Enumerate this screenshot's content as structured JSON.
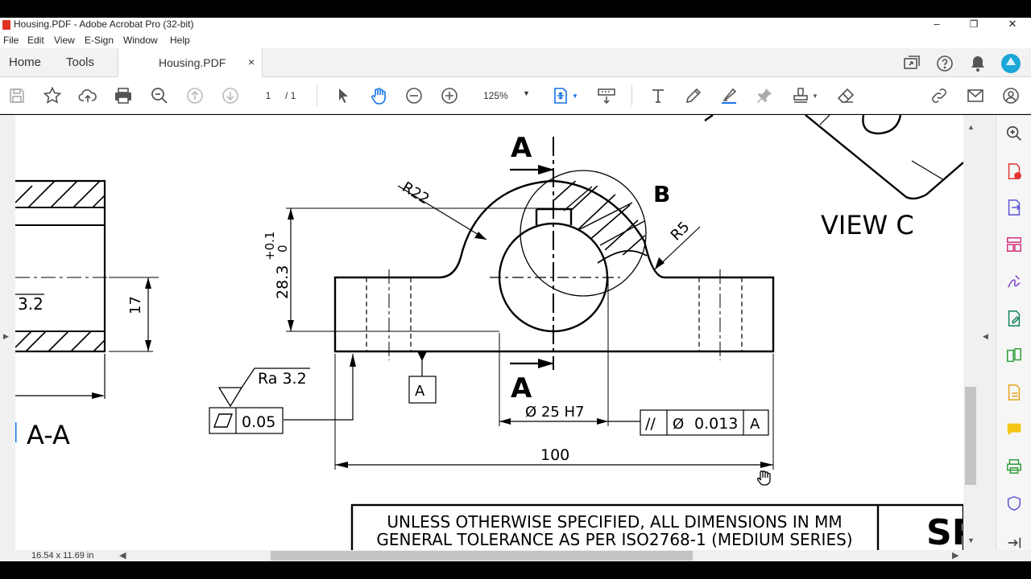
{
  "window": {
    "title": "Housing.PDF - Adobe Acrobat Pro (32-bit)",
    "minimize": "–",
    "restore": "❐",
    "close": "✕"
  },
  "menu": [
    "File",
    "Edit",
    "View",
    "E-Sign",
    "Window",
    "Help"
  ],
  "tabs": {
    "home": "Home",
    "tools": "Tools",
    "document": "Housing.PDF",
    "close": "×"
  },
  "toolbar": {
    "page_current": "1",
    "page_total": "/  1",
    "zoom": "125%",
    "icons": [
      "save-icon",
      "bookmark-star-icon",
      "cloud-upload-icon",
      "print-icon",
      "zoom-search-icon",
      "page-up-icon",
      "page-down-icon",
      "select-cursor-icon",
      "hand-tool-icon",
      "zoom-out-icon",
      "zoom-in-icon",
      "fit-page-icon",
      "scroll-mode-icon",
      "add-text-icon",
      "pen-icon",
      "highlighter-icon",
      "pin-icon",
      "stamp-icon",
      "eraser-icon",
      "link-icon",
      "mail-icon",
      "add-user-icon"
    ]
  },
  "drawing": {
    "section_label": "A-A",
    "view_label": "VIEW C",
    "detail_label": "B",
    "cut_label_top": "A",
    "cut_label_bottom": "A",
    "radius_large": "R22",
    "radius_small": "R5",
    "height_dim": "28.3",
    "height_tol_upper": "+0.1",
    "height_tol_lower": "0",
    "side_dim": "17",
    "left_partial_dim": "3.2",
    "roughness": "Ra 3.2",
    "flatness_value": "0.05",
    "datum": "A",
    "bore": "Ø 25 H7",
    "parallel_symbol": "//",
    "parallel_dia": "Ø",
    "parallel_value": "0.013",
    "parallel_datum": "A",
    "width_dim": "100",
    "note_line1": "UNLESS OTHERWISE SPECIFIED, ALL DIMENSIONS IN MM",
    "note_line2": "GENERAL TOLERANCE AS PER ISO2768-1 (MEDIUM SERIES)",
    "title_block_partial": "SP"
  },
  "right_pane": {
    "icons": [
      "search-tool-icon",
      "create-pdf-icon",
      "export-pdf-icon",
      "organize-pages-icon",
      "fill-sign-icon",
      "edit-pdf-icon",
      "compare-icon",
      "export-icon",
      "comment-icon",
      "print-production-icon",
      "protect-icon",
      "collapse-pane-icon"
    ]
  },
  "status": {
    "page_size": "16.54 x 11.69 in"
  }
}
